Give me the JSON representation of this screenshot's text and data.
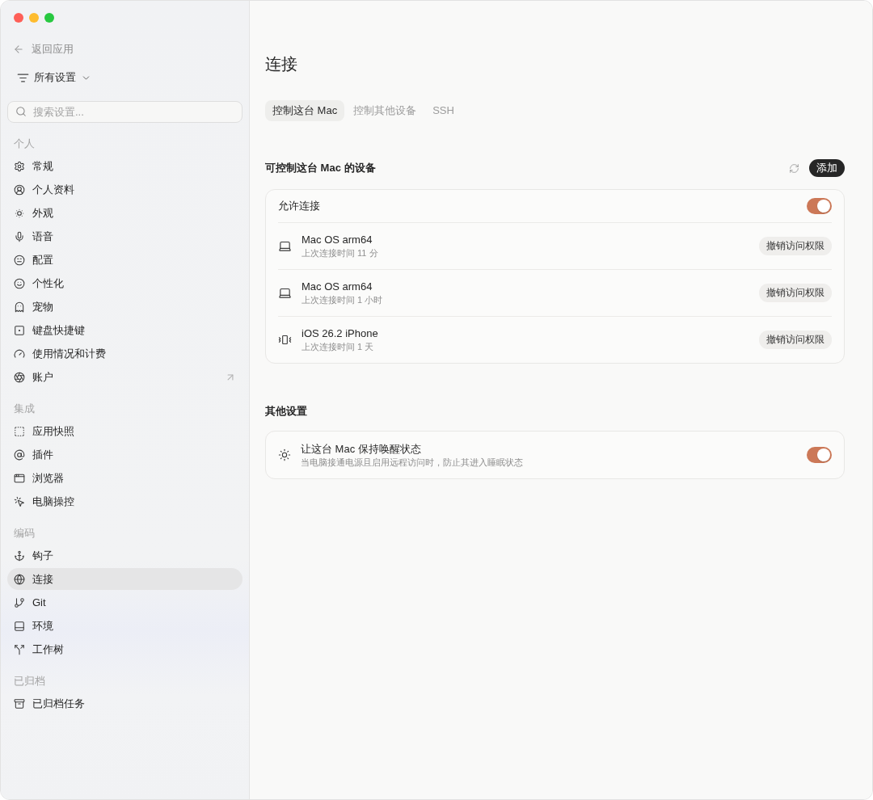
{
  "window": {
    "traffic_lights": [
      {
        "color": "#fe5f57"
      },
      {
        "color": "#febc2e"
      },
      {
        "color": "#28c840"
      }
    ]
  },
  "sidebar": {
    "back": {
      "label": "返回应用"
    },
    "filter": {
      "label": "所有设置"
    },
    "search": {
      "placeholder": "搜索设置..."
    },
    "groups": [
      {
        "title": "个人",
        "items": [
          {
            "label": "常规",
            "selected": false,
            "external": false
          },
          {
            "label": "个人资料",
            "selected": false,
            "external": false
          },
          {
            "label": "外观",
            "selected": false,
            "external": false
          },
          {
            "label": "语音",
            "selected": false,
            "external": false
          },
          {
            "label": "配置",
            "selected": false,
            "external": false
          },
          {
            "label": "个性化",
            "selected": false,
            "external": false
          },
          {
            "label": "宠物",
            "selected": false,
            "external": false
          },
          {
            "label": "键盘快捷键",
            "selected": false,
            "external": false
          },
          {
            "label": "使用情况和计费",
            "selected": false,
            "external": false
          },
          {
            "label": "账户",
            "selected": false,
            "external": true
          }
        ]
      },
      {
        "title": "集成",
        "items": [
          {
            "label": "应用快照",
            "selected": false,
            "external": false
          },
          {
            "label": "插件",
            "selected": false,
            "external": false
          },
          {
            "label": "浏览器",
            "selected": false,
            "external": false
          },
          {
            "label": "电脑操控",
            "selected": false,
            "external": false
          }
        ]
      },
      {
        "title": "编码",
        "items": [
          {
            "label": "钩子",
            "selected": false,
            "external": false
          },
          {
            "label": "连接",
            "selected": true,
            "external": false
          },
          {
            "label": "Git",
            "selected": false,
            "external": false
          },
          {
            "label": "环境",
            "selected": false,
            "external": false
          },
          {
            "label": "工作树",
            "selected": false,
            "external": false
          }
        ]
      },
      {
        "title": "已归档",
        "items": [
          {
            "label": "已归档任务",
            "selected": false,
            "external": false
          }
        ]
      }
    ]
  },
  "page": {
    "title": "连接",
    "tabs": [
      {
        "label": "控制这台 Mac",
        "selected": true
      },
      {
        "label": "控制其他设备",
        "selected": false
      },
      {
        "label": "SSH",
        "selected": false
      }
    ],
    "sections": [
      {
        "title": "可控制这台 Mac 的设备",
        "refresh": true,
        "add_button": "添加",
        "rows": [
          {
            "kind": "toggle",
            "label": "允许连接",
            "on": true
          },
          {
            "kind": "computer",
            "name": "Mac OS arm64",
            "detail": "上次连接时间 11 分",
            "action": "撤销访问权限"
          },
          {
            "kind": "computer",
            "name": "Mac OS arm64",
            "detail": "上次连接时间 1 小时",
            "action": "撤销访问权限"
          },
          {
            "kind": "phone",
            "name": "iOS 26.2 iPhone",
            "detail": "上次连接时间 1 天",
            "action": "撤销访问权限"
          }
        ]
      },
      {
        "title": "其他设置",
        "rows": [
          {
            "kind": "setting",
            "name": "让这台 Mac 保持唤醒状态",
            "detail": "当电脑接通电源且启用远程访问时，防止其进入睡眠状态",
            "on": true
          }
        ]
      }
    ]
  }
}
